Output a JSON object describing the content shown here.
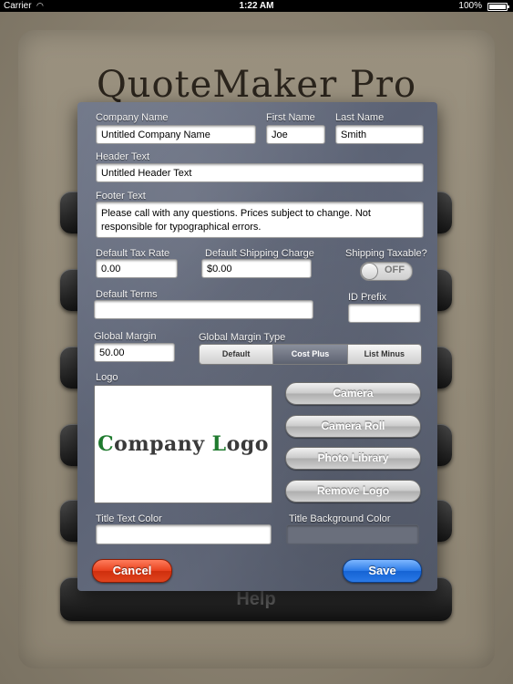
{
  "status_bar": {
    "carrier": "Carrier",
    "time": "1:22 AM",
    "battery": "100%"
  },
  "background": {
    "app_title": "QuoteMaker Pro",
    "help_label": "Help"
  },
  "form": {
    "company_name": {
      "label": "Company Name",
      "value": "Untitled Company Name"
    },
    "first_name": {
      "label": "First Name",
      "value": "Joe"
    },
    "last_name": {
      "label": "Last Name",
      "value": "Smith"
    },
    "header_text": {
      "label": "Header Text",
      "value": "Untitled Header Text"
    },
    "footer_text": {
      "label": "Footer Text",
      "value": "Please call with any questions. Prices subject to change. Not responsible for typographical errors."
    },
    "tax_rate": {
      "label": "Default Tax Rate",
      "value": "0.00"
    },
    "shipping_charge": {
      "label": "Default Shipping Charge",
      "value": "$0.00"
    },
    "shipping_taxable": {
      "label": "Shipping Taxable?",
      "state": "OFF"
    },
    "default_terms": {
      "label": "Default Terms",
      "value": ""
    },
    "id_prefix": {
      "label": "ID Prefix",
      "value": ""
    },
    "global_margin": {
      "label": "Global Margin",
      "value": "50.00"
    },
    "margin_type": {
      "label": "Global Margin Type",
      "options": [
        "Default",
        "Cost Plus",
        "List Minus"
      ],
      "selected": "Cost Plus"
    },
    "logo": {
      "label": "Logo",
      "text_first_letter": "C",
      "text_part1": "ompany ",
      "text_second_letter": "L",
      "text_part2": "ogo",
      "accent_color": "#1f7a2e"
    },
    "logo_buttons": {
      "camera": "Camera",
      "camera_roll": "Camera Roll",
      "photo_library": "Photo Library",
      "remove_logo": "Remove Logo"
    },
    "title_text_color": {
      "label": "Title Text Color",
      "value": ""
    },
    "title_background_color": {
      "label": "Title Background Color",
      "value": ""
    },
    "cancel_label": "Cancel",
    "save_label": "Save"
  }
}
